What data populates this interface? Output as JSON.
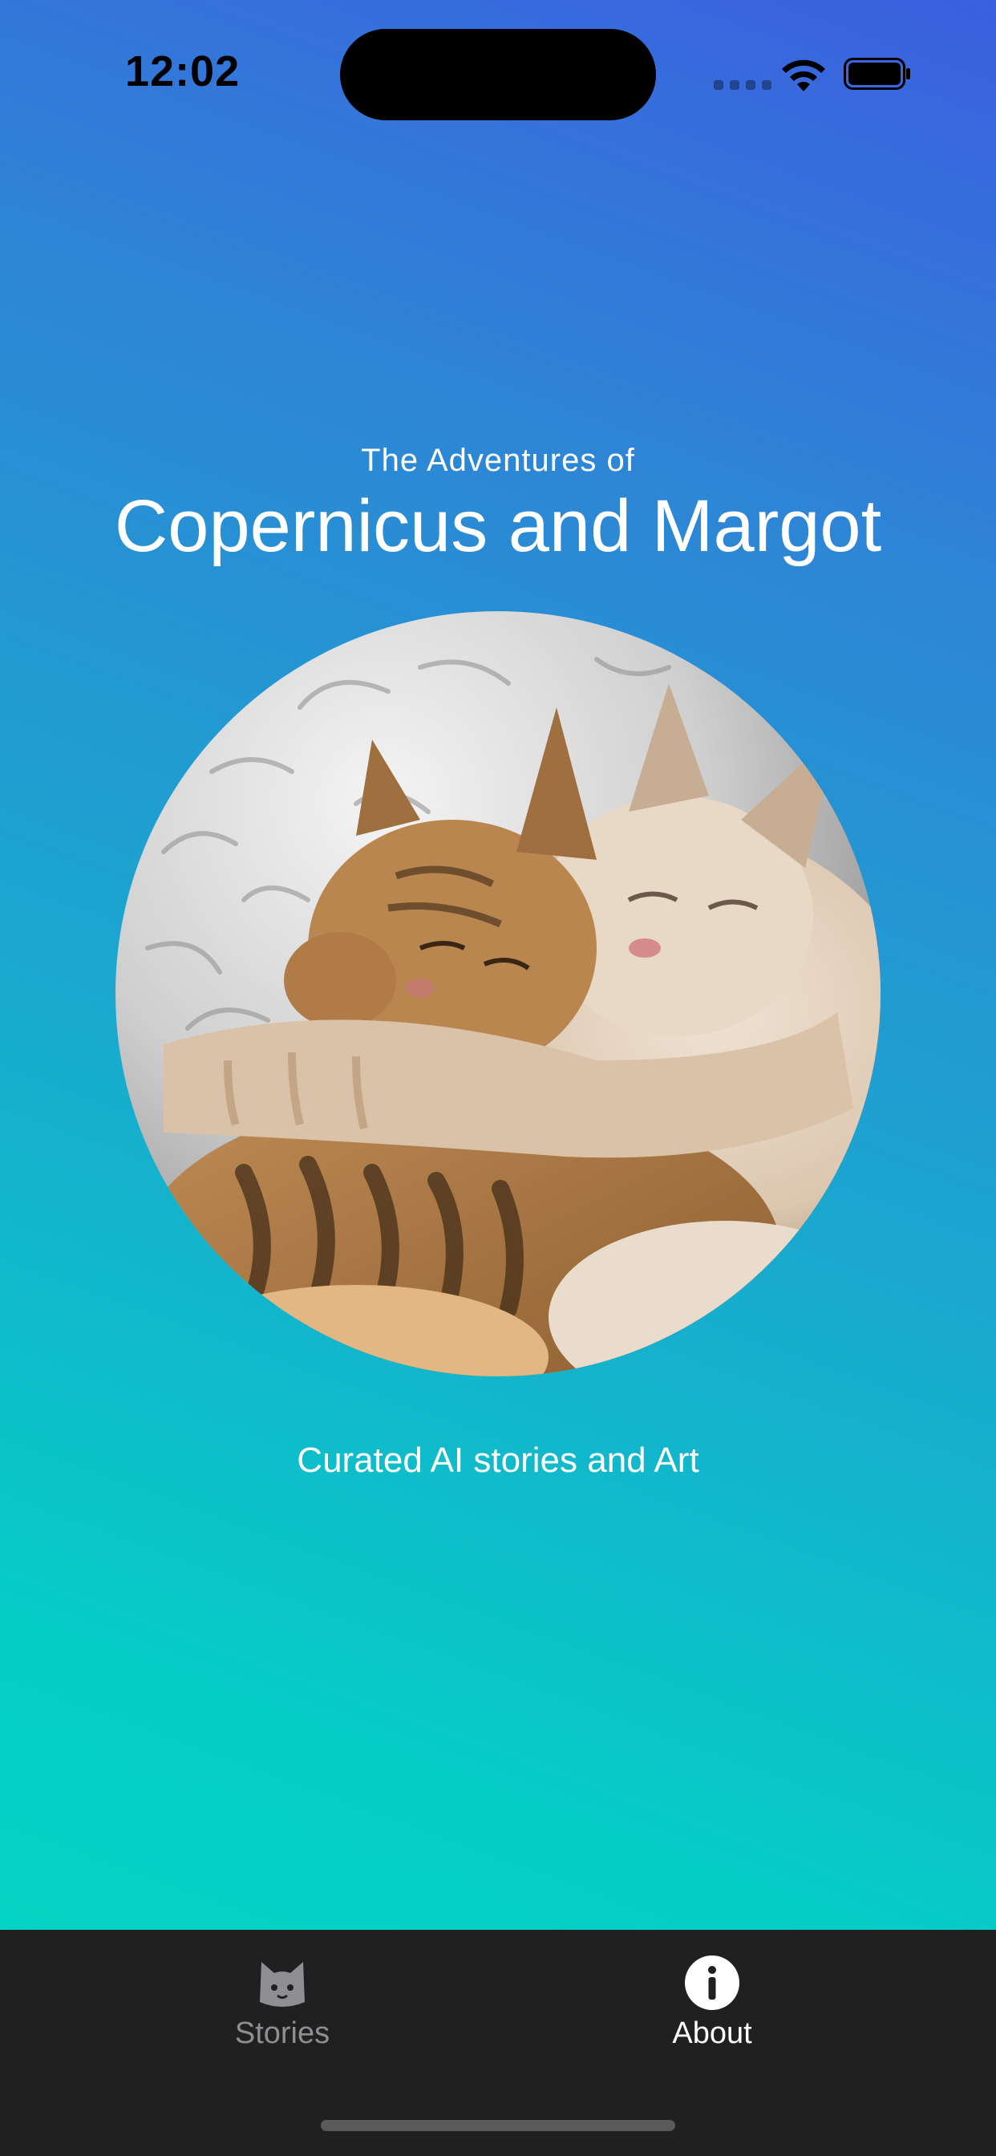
{
  "status_bar": {
    "time": "12:02",
    "icons": [
      "cellular-signal-icon",
      "wifi-icon",
      "battery-icon"
    ]
  },
  "hero": {
    "subtitle": "The Adventures of",
    "title": "Copernicus and Margot",
    "image": "two-cats-cuddling-photo",
    "tagline": "Curated AI stories and Art"
  },
  "tabbar": {
    "tabs": [
      {
        "label": "Stories",
        "icon": "cat-face-icon",
        "selected": false
      },
      {
        "label": "About",
        "icon": "info-circle-icon",
        "selected": true
      }
    ]
  },
  "colors": {
    "gradient_top_right": "#3b5fe0",
    "gradient_bottom_left": "#02d8c2",
    "tabbar_bg": "#202020",
    "tab_inactive": "#8e8e93",
    "tab_active": "#ffffff"
  }
}
